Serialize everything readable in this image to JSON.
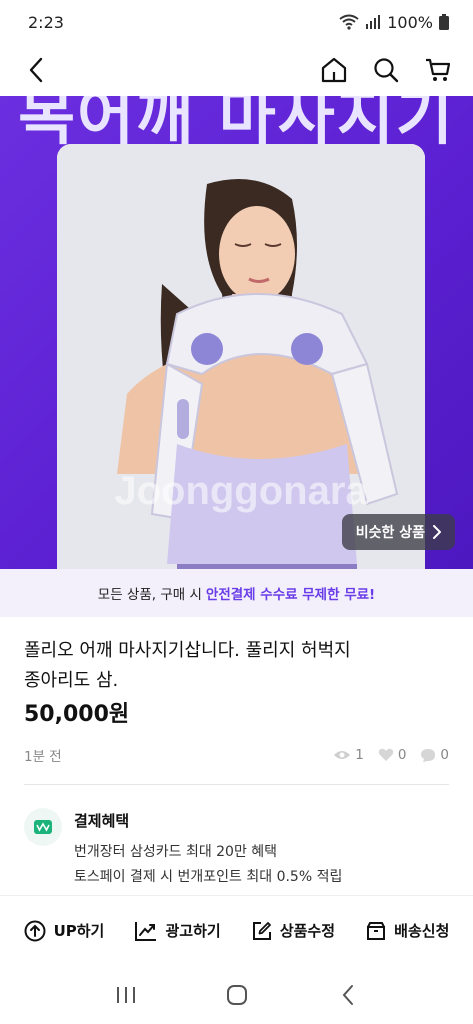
{
  "status": {
    "time": "2:23",
    "battery": "100%"
  },
  "hero": {
    "bigtext": "목어깨 마사지기",
    "watermark": "Joonggonara",
    "similar_label": "비슷한 상품"
  },
  "banner": {
    "prefix": "모든 상품, 구매 시",
    "highlight": "안전결제 수수료 무제한 무료!"
  },
  "product": {
    "title_line1": "폴리오 어깨 마사지기삽니다. 풀리지 허벅지",
    "title_line2": "종아리도 삼.",
    "price": "50,000원",
    "time_ago": "1분 전",
    "views": "1",
    "likes": "0",
    "chats": "0"
  },
  "benefit": {
    "title": "결제혜택",
    "line1": "번개장터 삼성카드 최대 20만 혜택",
    "line2": "토스페이 결제 시 번개포인트 최대 0.5% 적립"
  },
  "actions": {
    "up": "UP하기",
    "ad": "광고하기",
    "edit": "상품수정",
    "delivery": "배송신청"
  },
  "colors": {
    "accent": "#6a3de8",
    "hero_bg": "#5a1fd0"
  }
}
